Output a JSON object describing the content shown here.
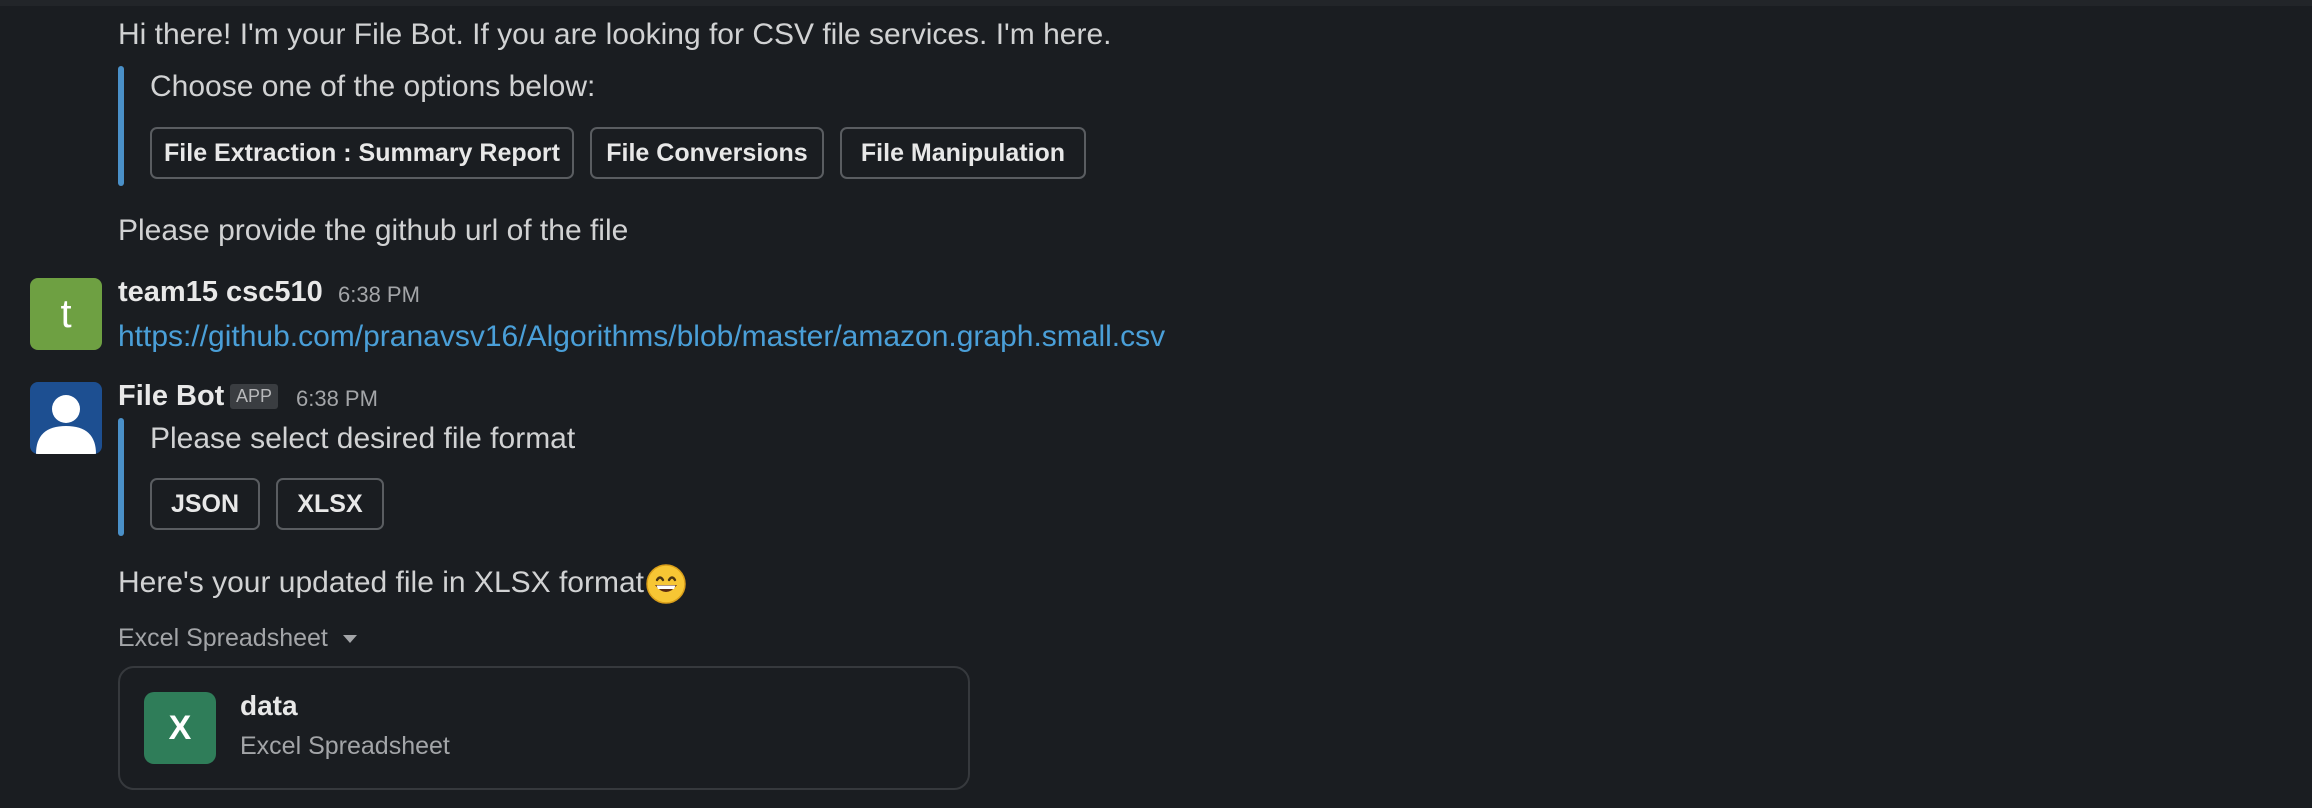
{
  "messages": {
    "greeting": "Hi there! I'm your File Bot. If you are looking for CSV file services. I'm here.",
    "options_block": {
      "prompt": "Choose one of the options below:",
      "buttons": [
        "File Extraction : Summary Report",
        "File Conversions",
        "File Manipulation"
      ]
    },
    "github_prompt": "Please provide the github url of the file",
    "user_message": {
      "avatar_initial": "t",
      "sender": "team15 csc510",
      "time": "6:38 PM",
      "link": "https://github.com/pranavsv16/Algorithms/blob/master/amazon.graph.small.csv"
    },
    "bot_message": {
      "sender": "File Bot",
      "badge": "APP",
      "time": "6:38 PM",
      "format_prompt": "Please select desired file format",
      "format_buttons": [
        "JSON",
        "XLSX"
      ]
    },
    "updated_file_text": "Here's your updated file in XLSX format",
    "file_attachment": {
      "label": "Excel Spreadsheet",
      "icon_letter": "X",
      "name": "data",
      "type": "Excel Spreadsheet"
    }
  },
  "colors": {
    "background": "#1a1d21",
    "block_bar": "#4a90c8",
    "link": "#4a9fd8",
    "user_avatar": "#6ea042",
    "bot_avatar": "#1d4f91",
    "excel_icon": "#2f7d59"
  },
  "icons": {
    "user_avatar": "letter-avatar",
    "bot_avatar": "person-silhouette-icon",
    "emoji": "grinning-face-emoji",
    "dropdown": "caret-down-icon",
    "file": "excel-icon"
  }
}
